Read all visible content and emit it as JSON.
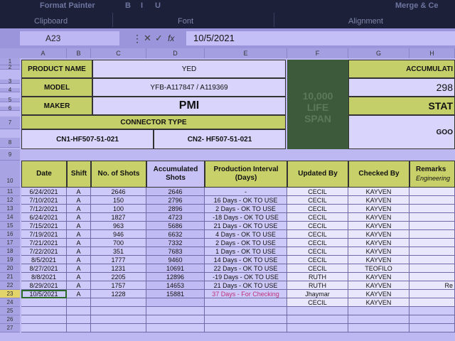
{
  "ribbon": {
    "top_text": "Format Painter",
    "clipboard": "Clipboard",
    "font": "Font",
    "alignment": "Alignment",
    "wrap_fragment": "Merge & Ce",
    "btn_b": "B",
    "btn_i": "I",
    "btn_u": "U"
  },
  "formula_bar": {
    "name_box": "A23",
    "formula": "10/5/2021",
    "fx_label": "fx"
  },
  "columns": [
    "A",
    "B",
    "C",
    "D",
    "E",
    "F",
    "G",
    "H"
  ],
  "rows": [
    "1",
    "2",
    "3",
    "4",
    "5",
    "6",
    "7",
    "8",
    "9",
    "10",
    "11",
    "12",
    "13",
    "14",
    "15",
    "16",
    "17",
    "18",
    "19",
    "20",
    "21",
    "22",
    "23",
    "24",
    "25",
    "26",
    "27"
  ],
  "info": {
    "product_name_label": "PRODUCT NAME",
    "product_name_value": "YED",
    "model_label": "MODEL",
    "model_value": "YFB-A117847 / A119369",
    "maker_label": "MAKER",
    "maker_value": "PMI",
    "connector_type_label": "CONNECTOR TYPE",
    "cn1": "CN1-HF507-51-021",
    "cn2": "CN2- HF507-51-021",
    "life_span_text": "10,000 LIFE SPAN",
    "accum_label": "ACCUMULATI",
    "accum_value": "298",
    "status_label": "STAT",
    "status_value": "GOO"
  },
  "table": {
    "headers": [
      "Date",
      "Shift",
      "No. of Shots",
      "Accumulated Shots",
      "Production Interval (Days)",
      "Updated By",
      "Checked By",
      "Remarks"
    ],
    "remarks_sub": "Engineering",
    "rows": [
      {
        "date": "6/24/2021",
        "shift": "A",
        "shots": "2646",
        "accum": "2646",
        "interval": "-",
        "updated": "CECIL",
        "checked": "KAYVEN",
        "remarks": ""
      },
      {
        "date": "7/10/2021",
        "shift": "A",
        "shots": "150",
        "accum": "2796",
        "interval": "16 Days - OK TO USE",
        "updated": "CECIL",
        "checked": "KAYVEN",
        "remarks": ""
      },
      {
        "date": "7/12/2021",
        "shift": "A",
        "shots": "100",
        "accum": "2896",
        "interval": "2 Days - OK TO USE",
        "updated": "CECIL",
        "checked": "KAYVEN",
        "remarks": ""
      },
      {
        "date": "6/24/2021",
        "shift": "A",
        "shots": "1827",
        "accum": "4723",
        "interval": "-18 Days - OK TO USE",
        "updated": "CECIL",
        "checked": "KAYVEN",
        "remarks": ""
      },
      {
        "date": "7/15/2021",
        "shift": "A",
        "shots": "963",
        "accum": "5686",
        "interval": "21 Days - OK TO USE",
        "updated": "CECIL",
        "checked": "KAYVEN",
        "remarks": ""
      },
      {
        "date": "7/19/2021",
        "shift": "A",
        "shots": "946",
        "accum": "6632",
        "interval": "4 Days - OK TO USE",
        "updated": "CECIL",
        "checked": "KAYVEN",
        "remarks": ""
      },
      {
        "date": "7/21/2021",
        "shift": "A",
        "shots": "700",
        "accum": "7332",
        "interval": "2 Days - OK TO USE",
        "updated": "CECIL",
        "checked": "KAYVEN",
        "remarks": ""
      },
      {
        "date": "7/22/2021",
        "shift": "A",
        "shots": "351",
        "accum": "7683",
        "interval": "1 Days - OK TO USE",
        "updated": "CECIL",
        "checked": "KAYVEN",
        "remarks": ""
      },
      {
        "date": "8/5/2021",
        "shift": "A",
        "shots": "1777",
        "accum": "9460",
        "interval": "14 Days - OK TO USE",
        "updated": "CECIL",
        "checked": "KAYVEN",
        "remarks": ""
      },
      {
        "date": "8/27/2021",
        "shift": "A",
        "shots": "1231",
        "accum": "10691",
        "interval": "22 Days - OK TO USE",
        "updated": "CECIL",
        "checked": "TEOFILO",
        "remarks": ""
      },
      {
        "date": "8/8/2021",
        "shift": "A",
        "shots": "2205",
        "accum": "12896",
        "interval": "-19 Days - OK TO USE",
        "updated": "RUTH",
        "checked": "KAYVEN",
        "remarks": ""
      },
      {
        "date": "8/29/2021",
        "shift": "A",
        "shots": "1757",
        "accum": "14653",
        "interval": "21 Days - OK TO USE",
        "updated": "RUTH",
        "checked": "KAYVEN",
        "remarks": "Re"
      },
      {
        "date": "10/5/2021",
        "shift": "A",
        "shots": "1228",
        "accum": "15881",
        "interval": "37 Days - For Checking",
        "updated": "Jhaymar",
        "checked": "KAYVEN",
        "remarks": ""
      },
      {
        "date": "",
        "shift": "",
        "shots": "",
        "accum": "",
        "interval": "",
        "updated": "CECIL",
        "checked": "KAYVEN",
        "remarks": ""
      }
    ]
  },
  "colors": {
    "label_green": "#c5cf6a",
    "dark_block": "#3d5a3a",
    "check_red": "#c0307a"
  }
}
